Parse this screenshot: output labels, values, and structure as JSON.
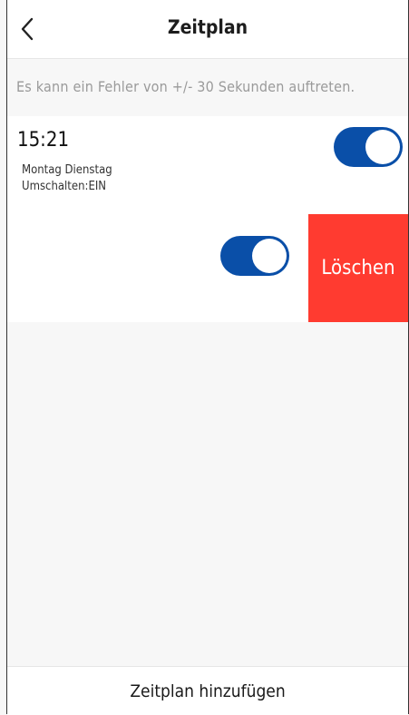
{
  "header": {
    "title": "Zeitplan",
    "back_icon": "chevron-left-icon"
  },
  "notice": "Es kann ein Fehler von +/- 30 Sekunden auftreten.",
  "schedules": [
    {
      "time": "15:21",
      "days": "Montag Dienstag",
      "action": "Umschalten:EIN",
      "enabled": true
    },
    {
      "enabled": true,
      "delete_label": "Löschen"
    }
  ],
  "footer": {
    "add_label": "Zeitplan hinzufügen"
  },
  "colors": {
    "toggle_on": "#0a4fa8",
    "delete_bg": "#ff3b30",
    "background": "#f7f7f7"
  }
}
